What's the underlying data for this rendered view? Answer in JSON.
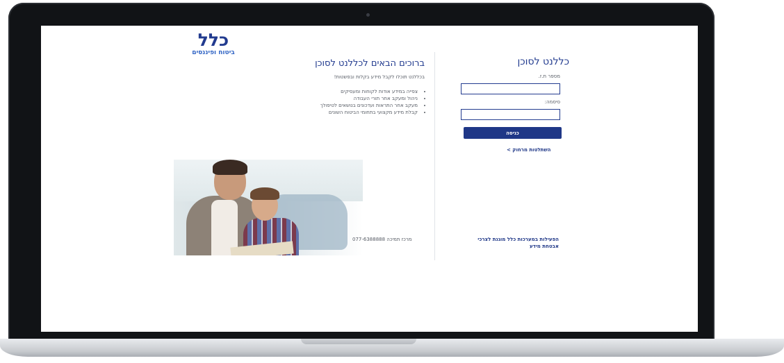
{
  "brand": {
    "name": "כלל",
    "tagline": "ביטוח ופיננסים",
    "primary_color": "#223b8f",
    "button_color": "#1f3787"
  },
  "welcome": {
    "title": "ברוכים הבאים לכללנט לסוכן",
    "subtitle": "בכללנט תוכלו לקבל מידע בקלות ובפשטות!",
    "features": [
      "צפייה במידע אודות לקוחות ומעסיקים",
      "ניהול ומעקב אחר תורי העבודה",
      "מעקב אחר התראות ועדכונים בנושאים לטיפולך",
      "קבלת מידע מקצועי בתחומי הביטוח השונים"
    ],
    "support_center": "מרכז תמיכה 077-6388888"
  },
  "login": {
    "title": "כללנט לסוכן",
    "id_label": "מספר ת.ז.",
    "id_value": "",
    "password_label": "סיסמה:",
    "password_value": "",
    "submit_label": "כניסה",
    "remote_link": "השתלטות מרחוק >",
    "security_note": "הפעילות במערכות כלל מוגנת לצרכי אבטחת מידע"
  }
}
